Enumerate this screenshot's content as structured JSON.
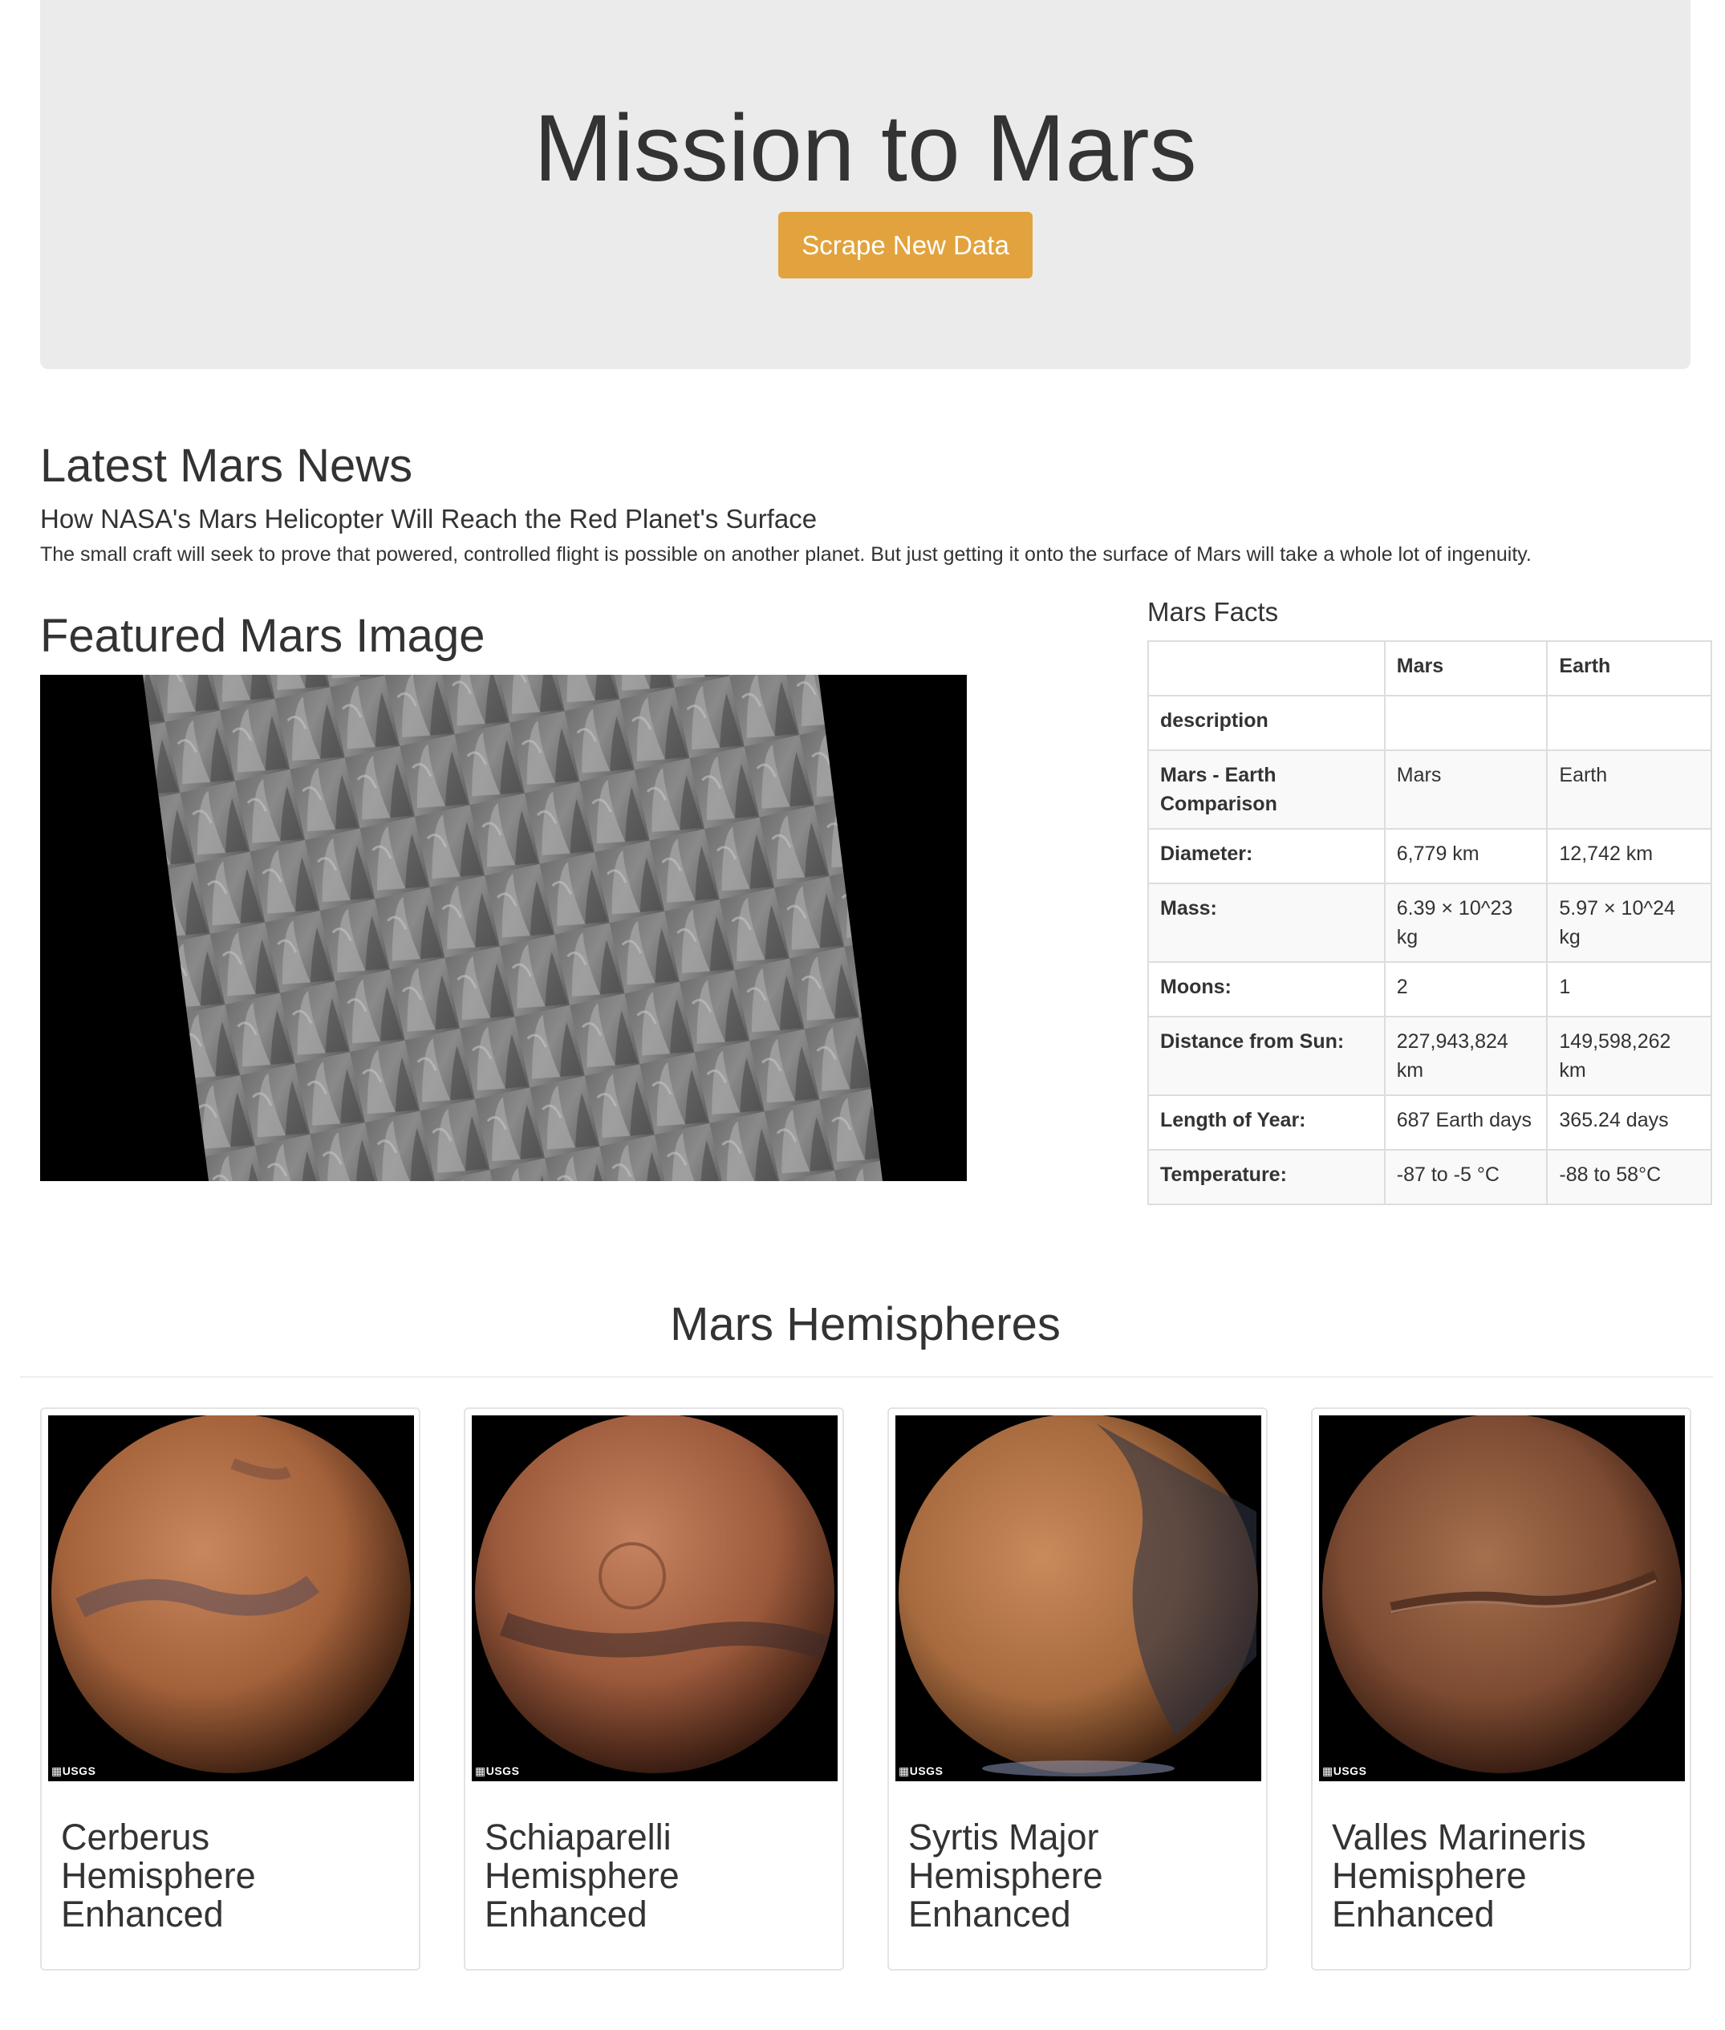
{
  "header": {
    "title": "Mission to Mars",
    "scrape_label": "Scrape New Data"
  },
  "news": {
    "heading": "Latest Mars News",
    "title": "How NASA's Mars Helicopter Will Reach the Red Planet's Surface",
    "body": "The small craft will seek to prove that powered, controlled flight is possible on another planet. But just getting it onto the surface of Mars will take a whole lot of ingenuity."
  },
  "featured": {
    "heading": "Featured Mars Image"
  },
  "facts": {
    "heading": "Mars Facts",
    "columns": [
      "",
      "Mars",
      "Earth"
    ],
    "rows": [
      {
        "label": "description",
        "mars": "",
        "earth": ""
      },
      {
        "label": "Mars - Earth Comparison",
        "mars": "Mars",
        "earth": "Earth"
      },
      {
        "label": "Diameter:",
        "mars": "6,779 km",
        "earth": "12,742 km"
      },
      {
        "label": "Mass:",
        "mars": "6.39 × 10^23 kg",
        "earth": "5.97 × 10^24 kg"
      },
      {
        "label": "Moons:",
        "mars": "2",
        "earth": "1"
      },
      {
        "label": "Distance from Sun:",
        "mars": "227,943,824 km",
        "earth": "149,598,262 km"
      },
      {
        "label": "Length of Year:",
        "mars": "687 Earth days",
        "earth": "365.24 days"
      },
      {
        "label": "Temperature:",
        "mars": "-87 to -5 °C",
        "earth": "-88 to 58°C"
      }
    ]
  },
  "hemispheres": {
    "heading": "Mars Hemispheres",
    "items": [
      {
        "name": "Cerberus Hemisphere Enhanced",
        "logo": "USGS"
      },
      {
        "name": "Schiaparelli Hemisphere Enhanced",
        "logo": "USGS"
      },
      {
        "name": "Syrtis Major Hemisphere Enhanced",
        "logo": "USGS"
      },
      {
        "name": "Valles Marineris Hemisphere Enhanced",
        "logo": "USGS"
      }
    ]
  },
  "colors": {
    "jumbotron_bg": "#ebebeb",
    "button_bg": "#e2a33e",
    "text": "#333333"
  }
}
